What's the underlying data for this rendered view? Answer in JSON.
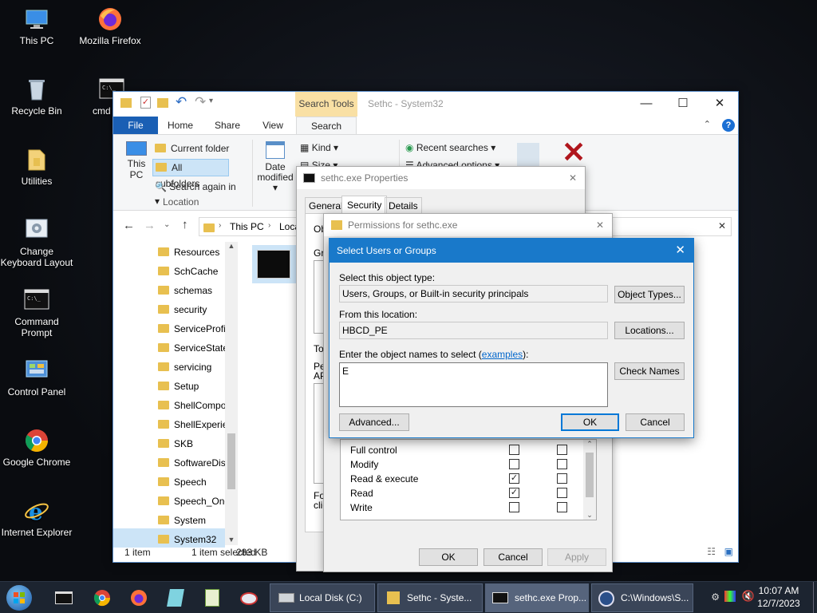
{
  "desktop": {
    "icons": [
      {
        "label": "This PC"
      },
      {
        "label": "Mozilla Firefox"
      },
      {
        "label": "Recycle Bin"
      },
      {
        "label": "cmd"
      },
      {
        "label": "Utilities"
      },
      {
        "label": "Change Keyboard Layout"
      },
      {
        "label": "Command Prompt"
      },
      {
        "label": "Control Panel"
      },
      {
        "label": "Google Chrome"
      },
      {
        "label": "Internet Explorer"
      }
    ]
  },
  "explorer": {
    "title": "Sethc - System32",
    "context_tab": "Search Tools",
    "tabs": [
      "File",
      "Home",
      "Share",
      "View",
      "Search"
    ],
    "ribbon": {
      "this_pc": "This PC",
      "current_folder": "Current folder",
      "all_subfolders": "All subfolders",
      "search_again": "Search again in",
      "location_group": "Location",
      "date_modified": "Date modified",
      "kind": "Kind",
      "size": "Size",
      "recent_searches": "Recent searches",
      "advanced_options": "Advanced options"
    },
    "address": {
      "crumb1": "This PC",
      "crumb2": "Loca"
    },
    "nav_items": [
      "Resources",
      "SchCache",
      "schemas",
      "security",
      "ServiceProfi",
      "ServiceState",
      "servicing",
      "Setup",
      "ShellCompo",
      "ShellExperie",
      "SKB",
      "SoftwareDis",
      "Speech",
      "Speech_One",
      "System",
      "System32"
    ],
    "status": {
      "items": "1 item",
      "selected": "1 item selected",
      "size": "283 KB"
    }
  },
  "properties": {
    "title": "sethc.exe Properties",
    "tabs": [
      "General",
      "Security",
      "Details"
    ],
    "frag_ob": "Ob",
    "frag_gr": "Gr",
    "frag_to": "To",
    "frag_pe": "Pe",
    "frag_ap": "AP",
    "frag_fo": "Fo",
    "frag_cli": "clic"
  },
  "permissions": {
    "title": "Permissions for sethc.exe",
    "rows": [
      {
        "label": "Full control",
        "allow": false,
        "deny": false
      },
      {
        "label": "Modify",
        "allow": false,
        "deny": false
      },
      {
        "label": "Read & execute",
        "allow": true,
        "deny": false
      },
      {
        "label": "Read",
        "allow": true,
        "deny": false
      },
      {
        "label": "Write",
        "allow": false,
        "deny": false
      }
    ],
    "ok": "OK",
    "cancel": "Cancel",
    "apply": "Apply"
  },
  "select_dialog": {
    "title": "Select Users or Groups",
    "object_type_label": "Select this object type:",
    "object_type_value": "Users, Groups, or Built-in security principals",
    "object_types_btn": "Object Types...",
    "location_label": "From this location:",
    "location_value": "HBCD_PE",
    "locations_btn": "Locations...",
    "names_label_prefix": "Enter the object names to select (",
    "names_label_link": "examples",
    "names_label_suffix": "):",
    "names_value": "E",
    "check_names_btn": "Check Names",
    "advanced_btn": "Advanced...",
    "ok_btn": "OK",
    "cancel_btn": "Cancel"
  },
  "taskbar": {
    "tasks": [
      "Local Disk (C:)",
      "Sethc - Syste...",
      "sethc.exe Prop...",
      "C:\\Windows\\S..."
    ],
    "time": "10:07 AM",
    "date": "12/7/2023"
  }
}
